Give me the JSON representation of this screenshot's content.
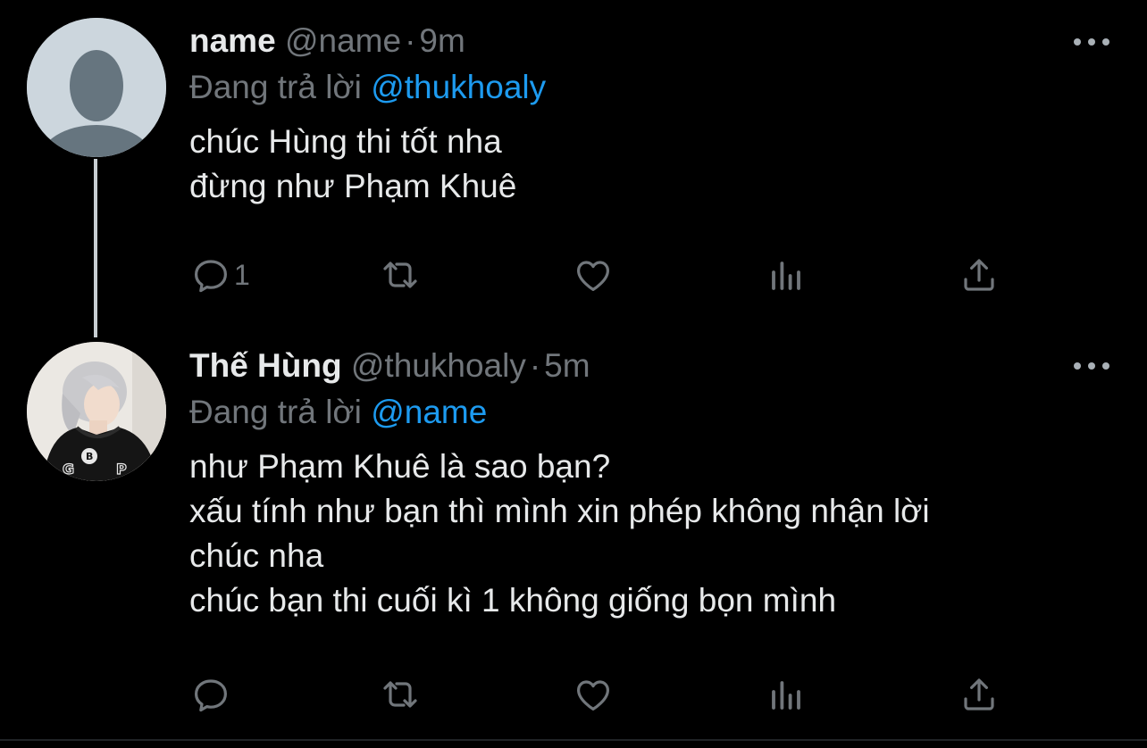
{
  "tweets": [
    {
      "display_name": "name",
      "handle": "@name",
      "separator": "·",
      "time": "9m",
      "reply_prefix": "Đang trả lời",
      "reply_to": "@thukhoaly",
      "lines": [
        "chúc Hùng thi tốt nha",
        "đừng như Phạm Khuê"
      ],
      "reply_count": "1"
    },
    {
      "display_name": "Thế Hùng",
      "handle": "@thukhoaly",
      "separator": "·",
      "time": "5m",
      "reply_prefix": "Đang trả lời",
      "reply_to": "@name",
      "lines": [
        "như Phạm Khuê là sao bạn?",
        "xấu tính như bạn thì mình xin phép không nhận lời",
        "chúc nha",
        "chúc bạn thi cuối kì 1 không giống bọn mình"
      ],
      "reply_count": ""
    }
  ],
  "colors": {
    "background": "#000000",
    "text": "#e7e9ea",
    "secondary": "#71767b",
    "mention": "#1d9bf0",
    "icon": "#71767b"
  },
  "icons": [
    "reply-icon",
    "retweet-icon",
    "like-icon",
    "analytics-icon",
    "share-icon",
    "more-icon"
  ]
}
